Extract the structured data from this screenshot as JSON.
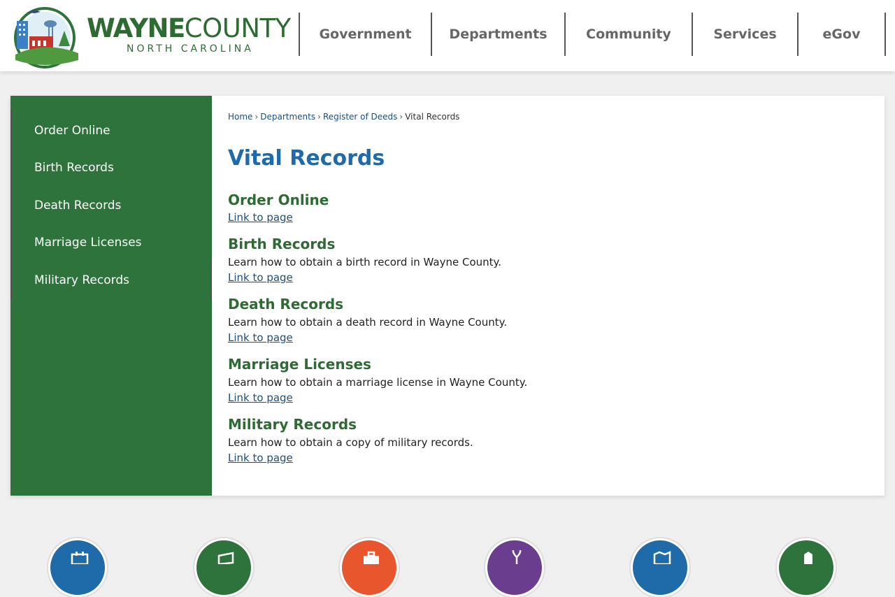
{
  "header": {
    "logo": {
      "name_bold": "WAYNE",
      "name_light": "COUNTY",
      "state": "NORTH CAROLINA"
    },
    "nav": [
      "Government",
      "Departments",
      "Community",
      "Services",
      "eGov"
    ]
  },
  "sidebar": {
    "items": [
      "Order Online",
      "Birth Records",
      "Death Records",
      "Marriage Licenses",
      "Military Records"
    ]
  },
  "breadcrumb": {
    "items": [
      "Home",
      "Departments",
      "Register of Deeds"
    ],
    "current": "Vital Records",
    "separator": "›"
  },
  "main": {
    "title": "Vital Records",
    "entries": [
      {
        "title": "Order Online",
        "description": "",
        "link": "Link to page"
      },
      {
        "title": "Birth Records",
        "description": "Learn how to obtain a birth record in Wayne County.",
        "link": "Link to page"
      },
      {
        "title": "Death Records",
        "description": "Learn how to obtain a death record in Wayne County.",
        "link": "Link to page"
      },
      {
        "title": "Marriage Licenses",
        "description": "Learn how to obtain a marriage license in Wayne County.",
        "link": "Link to page"
      },
      {
        "title": "Military Records",
        "description": "Learn how to obtain a copy of military records.",
        "link": "Link to page"
      }
    ]
  },
  "quick_icons": [
    {
      "icon": "calendar-icon",
      "color": "#1f6aa8"
    },
    {
      "icon": "payment-icon",
      "color": "#2e733b"
    },
    {
      "icon": "briefcase-icon",
      "color": "#e8562e"
    },
    {
      "icon": "plant-icon",
      "color": "#6a3d8f"
    },
    {
      "icon": "map-icon",
      "color": "#1f6aa8"
    },
    {
      "icon": "badge-icon",
      "color": "#2e733b"
    }
  ],
  "colors": {
    "brand_green": "#2e733b",
    "title_blue": "#1f6aa8",
    "link_blue": "#1f4f7a",
    "heading_green": "#2e6b33"
  }
}
